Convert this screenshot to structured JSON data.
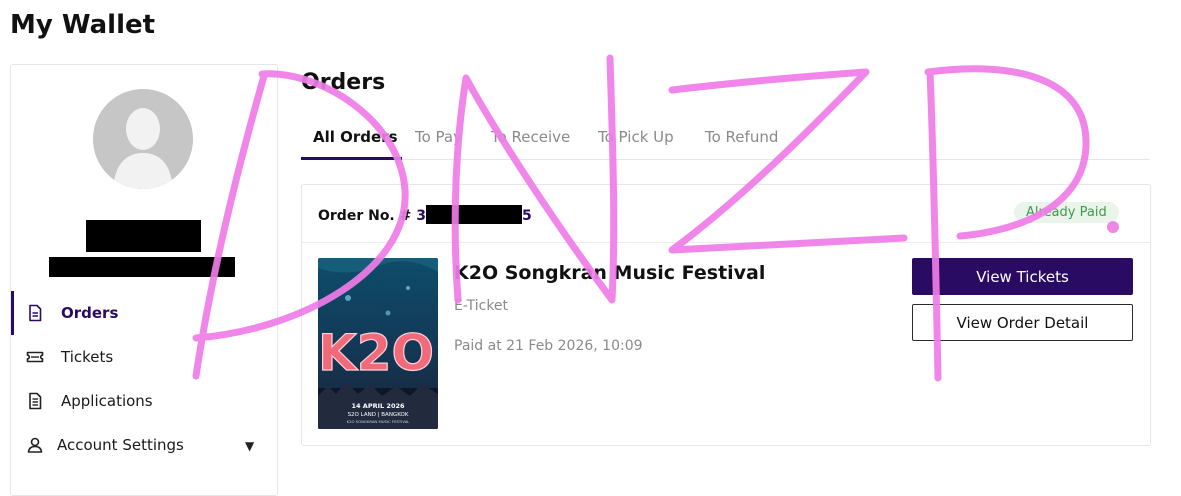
{
  "page": {
    "title": "My Wallet"
  },
  "sidebar": {
    "items": [
      {
        "label": "Orders",
        "icon": "document-icon",
        "active": true
      },
      {
        "label": "Tickets",
        "icon": "ticket-icon"
      },
      {
        "label": "Applications",
        "icon": "document-list-icon"
      },
      {
        "label": "Account Settings",
        "icon": "user-icon",
        "caret": "▼"
      }
    ]
  },
  "main": {
    "title": "Orders",
    "tabs": [
      {
        "label": "All Orders",
        "active": true
      },
      {
        "label": "To Pay"
      },
      {
        "label": "To Receive"
      },
      {
        "label": "To Pick Up"
      },
      {
        "label": "To Refund"
      }
    ]
  },
  "order": {
    "number_label": "Order No. #",
    "number_prefix": "3",
    "number_suffix": "5",
    "status": "Already Paid",
    "event_title": "K2O Songkran Music Festival",
    "ticket_type": "E-Ticket",
    "paid_at": "Paid at 21 Feb 2026, 10:09",
    "poster": {
      "date_text": "14 APRIL 2026",
      "venue_text": "S2O LAND | BANGKOK",
      "sub_text": "K2O SONGKRAN MUSIC FESTIVAL"
    },
    "view_tickets_label": "View Tickets",
    "view_order_label": "View Order Detail"
  },
  "annotation": {
    "text": "DNZP."
  },
  "colors": {
    "brand": "#2a0b63",
    "status_green": "#3e9a4a",
    "status_bg": "#e9f4ea",
    "scribble": "#f07ce8"
  }
}
